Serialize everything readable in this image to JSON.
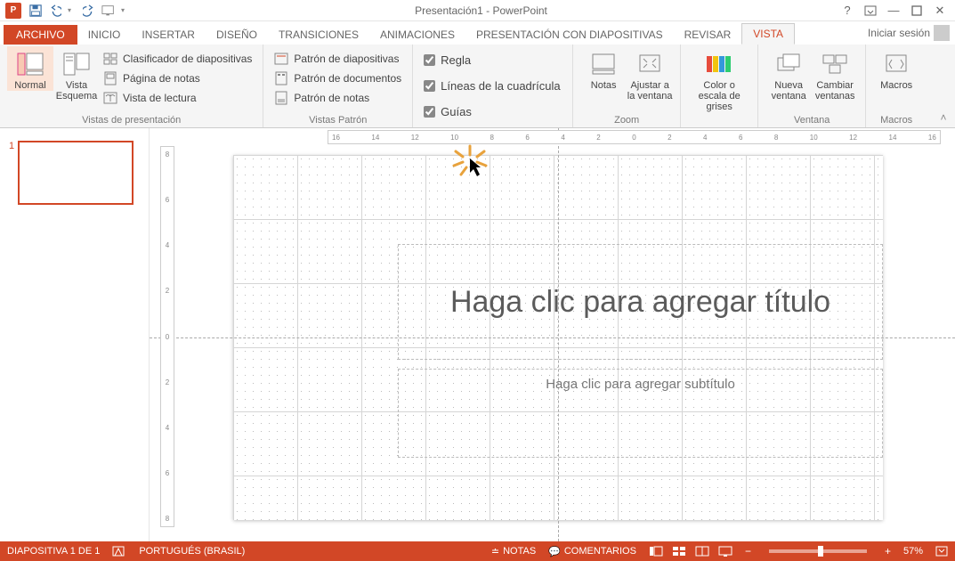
{
  "title": "Presentación1 - PowerPoint",
  "signin": "Iniciar sesión",
  "tabs": {
    "file": "ARCHIVO",
    "home": "INICIO",
    "insert": "INSERTAR",
    "design": "DISEÑO",
    "transitions": "TRANSICIONES",
    "animations": "ANIMACIONES",
    "slideshow": "PRESENTACIÓN CON DIAPOSITIVAS",
    "review": "REVISAR",
    "view": "VISTA"
  },
  "ribbon": {
    "views": {
      "label": "Vistas de presentación",
      "normal": "Normal",
      "outline": "Vista Esquema",
      "sorter": "Clasificador de diapositivas",
      "notes_page": "Página de notas",
      "reading": "Vista de lectura"
    },
    "master": {
      "label": "Vistas Patrón",
      "slide": "Patrón de diapositivas",
      "handout": "Patrón de documentos",
      "notes": "Patrón de notas"
    },
    "show": {
      "ruler": "Regla",
      "gridlines": "Líneas de la cuadrícula",
      "guides": "Guías"
    },
    "zoom": {
      "label": "Zoom",
      "notes": "Notas",
      "fit": "Ajustar a la ventana"
    },
    "color": {
      "btn": "Color o escala de grises"
    },
    "window": {
      "label": "Ventana",
      "new": "Nueva ventana",
      "switch": "Cambiar ventanas"
    },
    "macros": {
      "label": "Macros",
      "btn": "Macros"
    }
  },
  "ruler_marks_h": [
    "16",
    "14",
    "12",
    "10",
    "8",
    "6",
    "4",
    "2",
    "0",
    "2",
    "4",
    "6",
    "8",
    "10",
    "12",
    "14",
    "16"
  ],
  "ruler_marks_v": [
    "8",
    "6",
    "4",
    "2",
    "0",
    "2",
    "4",
    "6",
    "8"
  ],
  "slide": {
    "number": "1",
    "title_placeholder": "Haga clic para agregar título",
    "subtitle_placeholder": "Haga clic para agregar subtítulo"
  },
  "status": {
    "slide_count": "DIAPOSITIVA 1 DE 1",
    "language": "PORTUGUÉS (BRASIL)",
    "notes": "NOTAS",
    "comments": "COMENTARIOS",
    "zoom": "57%"
  }
}
